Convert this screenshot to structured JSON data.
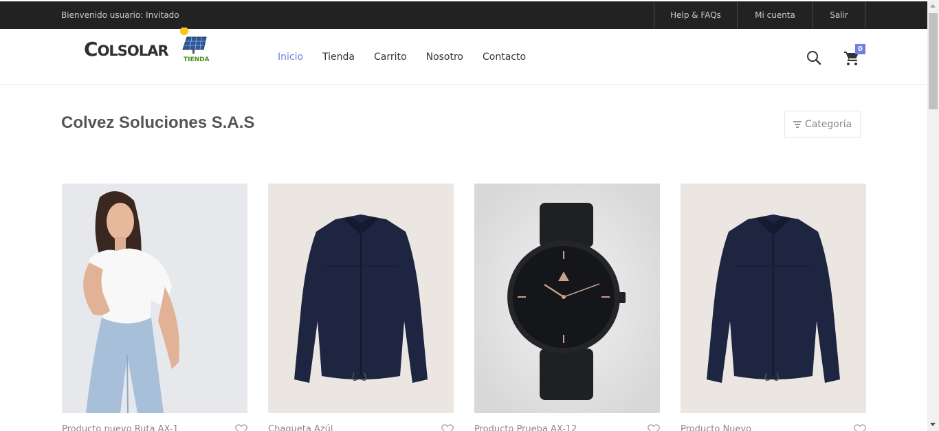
{
  "topbar": {
    "welcome": "Bienvenido usuario: Invitado",
    "links": [
      "Help & FAQs",
      "Mi cuenta",
      "Salir"
    ]
  },
  "header": {
    "logo_text_big": "C",
    "logo_text_rest": "OLSOLAR",
    "logo_sub": "TIENDA",
    "nav": [
      "Inicio",
      "Tienda",
      "Carrito",
      "Nosotro",
      "Contacto"
    ],
    "active_nav": "Inicio",
    "cart_count": "0",
    "accent": "#717fe0"
  },
  "page": {
    "title": "Colvez Soluciones S.A.S",
    "filter_label": "Categoría"
  },
  "products": [
    {
      "name": "Producto nuevo Ruta AX-1",
      "image": "woman-white-tshirt-jeans"
    },
    {
      "name": "Chaqueta Azúl",
      "image": "navy-jacket"
    },
    {
      "name": "Producto Prueba AX-12",
      "image": "black-watch"
    },
    {
      "name": "Producto Nuevo",
      "image": "navy-jacket"
    }
  ]
}
